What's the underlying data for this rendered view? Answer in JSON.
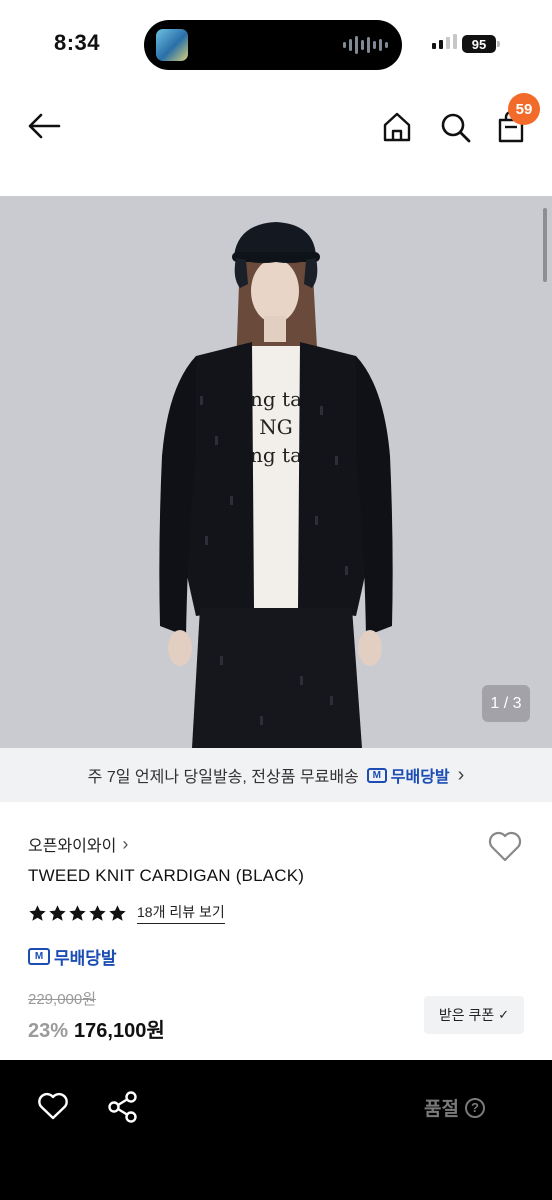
{
  "status_bar": {
    "time": "8:34",
    "battery": "95"
  },
  "header": {
    "back_icon": "arrow-left-icon",
    "home_icon": "home-icon",
    "search_icon": "search-icon",
    "cart_icon": "shopping-bag-icon",
    "cart_badge": "59"
  },
  "gallery": {
    "counter": "1 / 3"
  },
  "shipping_banner": {
    "text": "주 7일 언제나 당일발송, 전상품 무료배송",
    "logo_text": "무배당발",
    "logo_mark": "M",
    "chevron": "›"
  },
  "product": {
    "brand": "오픈와이와이",
    "brand_chevron": "›",
    "title": "TWEED KNIT CARDIGAN (BLACK)",
    "rating_stars": 5,
    "review_link": "18개 리뷰 보기",
    "free_shipping_label": "무배당발",
    "free_shipping_mark": "M",
    "original_price": "229,000원",
    "discount": "23%",
    "price": "176,100원",
    "coupon_button": "받은 쿠폰",
    "coupon_chevron": "✓"
  },
  "bottom_bar": {
    "soldout_label": "품절",
    "help_mark": "?"
  },
  "colors": {
    "accent_badge": "#f26b2a",
    "brand_blue": "#1b4db3",
    "muted_gray": "#9a9a9a"
  }
}
